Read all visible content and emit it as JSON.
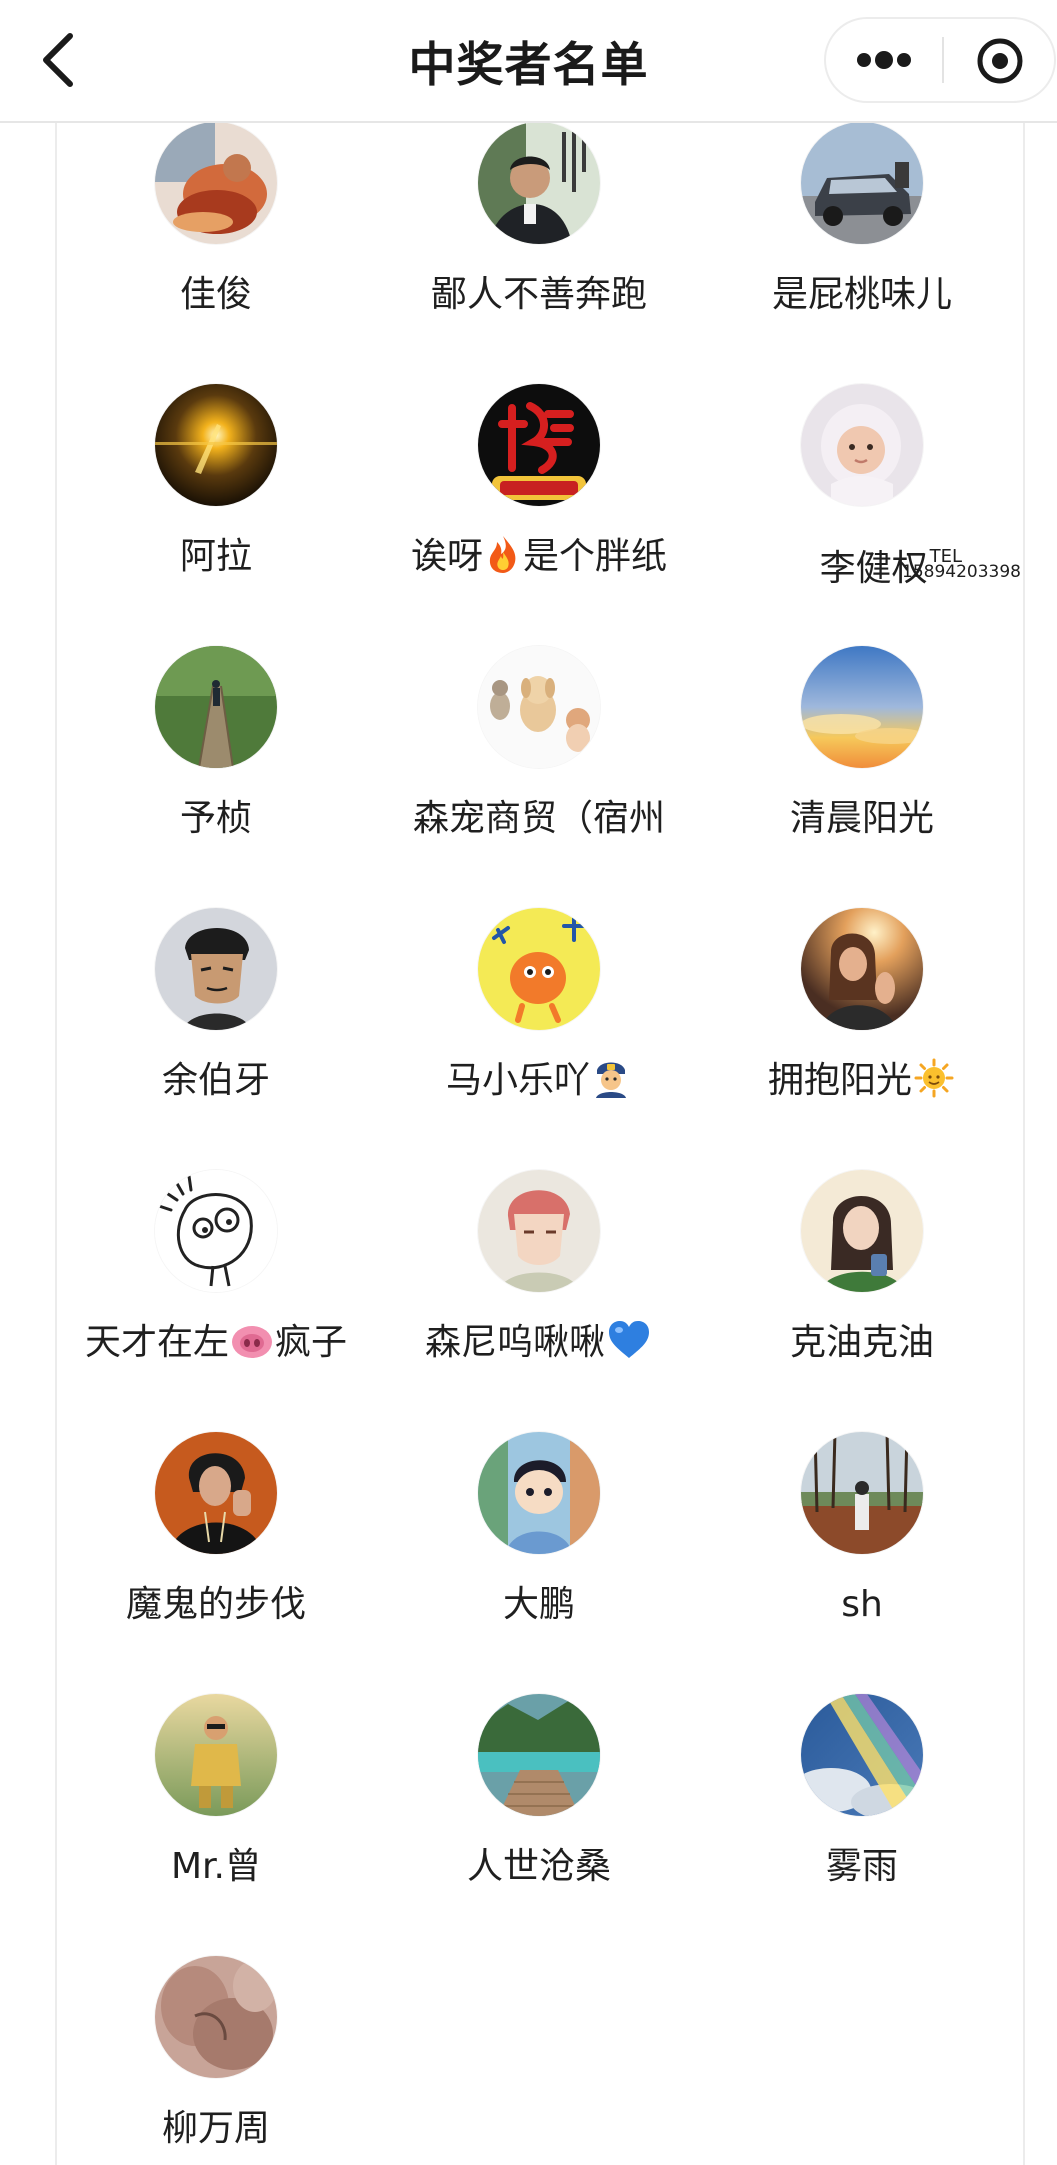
{
  "header": {
    "title": "中奖者名单",
    "back_icon": "chevron-left-icon",
    "more_icon": "more-dots-icon",
    "close_icon": "target-close-icon"
  },
  "winners": [
    {
      "name": "佳俊",
      "avatar_icon": "avatar-cat-fire"
    },
    {
      "name": "鄙人不善奔跑",
      "avatar_icon": "avatar-man-portrait"
    },
    {
      "name": "是屁桃味儿",
      "avatar_icon": "avatar-car"
    },
    {
      "name": "阿拉",
      "avatar_icon": "avatar-sunset-light"
    },
    {
      "name": "诶呀",
      "name_after": "是个胖纸",
      "emoji": "fire-emoji",
      "avatar_icon": "avatar-red-calligraphy"
    },
    {
      "name": "李健权",
      "sup": "TEL",
      "tel": "15894203398",
      "avatar_icon": "avatar-baby"
    },
    {
      "name": "予桢",
      "avatar_icon": "avatar-forest-path"
    },
    {
      "name": "森宠商贸（宿州",
      "avatar_icon": "avatar-pets"
    },
    {
      "name": "清晨阳光",
      "avatar_icon": "avatar-sky-clouds"
    },
    {
      "name": "余伯牙",
      "avatar_icon": "avatar-cartoon-man"
    },
    {
      "name": "马小乐吖",
      "emoji_after": "police-officer-emoji",
      "avatar_icon": "avatar-cartoon-orange"
    },
    {
      "name": "拥抱阳光",
      "emoji_after": "sun-emoji",
      "avatar_icon": "avatar-girl-sunset"
    },
    {
      "name": "天才在左",
      "name_after": "疯子",
      "emoji": "pig-nose-emoji",
      "avatar_icon": "avatar-doodle"
    },
    {
      "name": "森尼呜啾啾",
      "emoji_after": "blue-heart-emoji",
      "avatar_icon": "avatar-anime-boy"
    },
    {
      "name": "克油克油",
      "avatar_icon": "avatar-illustrated-girl"
    },
    {
      "name": "魔鬼的步伐",
      "avatar_icon": "avatar-woman-black"
    },
    {
      "name": "大鹏",
      "avatar_icon": "avatar-cartoon-kid"
    },
    {
      "name": "sh",
      "avatar_icon": "avatar-park-trees"
    },
    {
      "name": "Mr.曾",
      "avatar_icon": "avatar-kid-outfit"
    },
    {
      "name": "人世沧桑",
      "avatar_icon": "avatar-lake-dock"
    },
    {
      "name": "雾雨",
      "avatar_icon": "avatar-rainbow-sky"
    },
    {
      "name": "柳万周",
      "avatar_icon": "avatar-hand-closeup"
    }
  ]
}
